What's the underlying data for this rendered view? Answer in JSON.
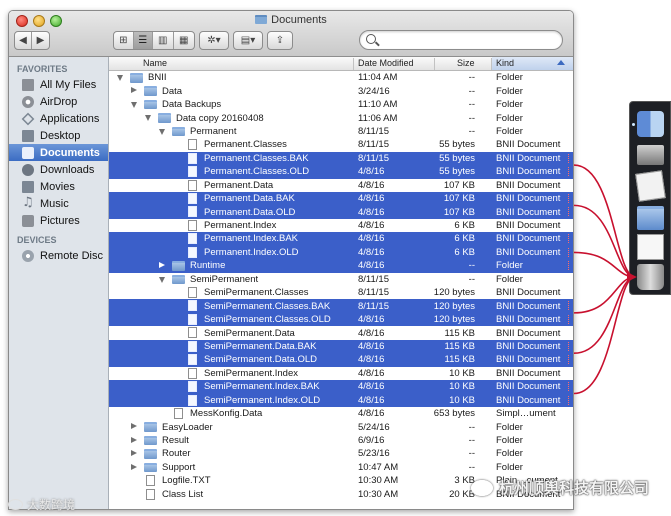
{
  "window": {
    "title": "Documents"
  },
  "toolbar": {
    "back_symbol": "◀",
    "forward_symbol": "▶",
    "view_icons": "⊞",
    "view_list": "☰",
    "view_columns": "▥",
    "view_coverflow": "▦",
    "action_symbol": "✲▾",
    "arrange_symbol": "▤▾",
    "share_symbol": "⇪",
    "search_value": "",
    "search_placeholder": ""
  },
  "sidebar": {
    "favorites_header": "FAVORITES",
    "devices_header": "DEVICES",
    "favorites": [
      {
        "label": "All My Files",
        "icon": "files-icon"
      },
      {
        "label": "AirDrop",
        "icon": "airdrop-icon"
      },
      {
        "label": "Applications",
        "icon": "applications-icon"
      },
      {
        "label": "Desktop",
        "icon": "desktop-icon"
      },
      {
        "label": "Documents",
        "icon": "documents-icon",
        "selected": true
      },
      {
        "label": "Downloads",
        "icon": "downloads-icon"
      },
      {
        "label": "Movies",
        "icon": "movies-icon"
      },
      {
        "label": "Music",
        "icon": "music-icon"
      },
      {
        "label": "Pictures",
        "icon": "pictures-icon"
      }
    ],
    "devices": [
      {
        "label": "Remote Disc",
        "icon": "disc-icon"
      }
    ]
  },
  "columns": {
    "name": "Name",
    "date": "Date Modified",
    "size": "Size",
    "kind": "Kind"
  },
  "rows": [
    {
      "name": "BNII",
      "date": "11:04 AM",
      "size": "--",
      "kind": "Folder",
      "type": "folder",
      "depth": 0,
      "disclosure": "open"
    },
    {
      "name": "Data",
      "date": "3/24/16",
      "size": "--",
      "kind": "Folder",
      "type": "folder",
      "depth": 1,
      "disclosure": "closed"
    },
    {
      "name": "Data Backups",
      "date": "11:10 AM",
      "size": "--",
      "kind": "Folder",
      "type": "folder",
      "depth": 1,
      "disclosure": "open"
    },
    {
      "name": "Data copy 20160408",
      "date": "11:06 AM",
      "size": "--",
      "kind": "Folder",
      "type": "folder",
      "depth": 2,
      "disclosure": "open"
    },
    {
      "name": "Permanent",
      "date": "8/11/15",
      "size": "--",
      "kind": "Folder",
      "type": "folder",
      "depth": 3,
      "disclosure": "open"
    },
    {
      "name": "Permanent.Classes",
      "date": "8/11/15",
      "size": "55 bytes",
      "kind": "BNII Document",
      "type": "doc",
      "depth": 4
    },
    {
      "name": "Permanent.Classes.BAK",
      "date": "8/11/15",
      "size": "55 bytes",
      "kind": "BNII Document",
      "type": "doc",
      "depth": 4,
      "selected": true
    },
    {
      "name": "Permanent.Classes.OLD",
      "date": "4/8/16",
      "size": "55 bytes",
      "kind": "BNII Document",
      "type": "doc",
      "depth": 4,
      "selected": true
    },
    {
      "name": "Permanent.Data",
      "date": "4/8/16",
      "size": "107 KB",
      "kind": "BNII Document",
      "type": "doc",
      "depth": 4
    },
    {
      "name": "Permanent.Data.BAK",
      "date": "4/8/16",
      "size": "107 KB",
      "kind": "BNII Document",
      "type": "doc",
      "depth": 4,
      "selected": true
    },
    {
      "name": "Permanent.Data.OLD",
      "date": "4/8/16",
      "size": "107 KB",
      "kind": "BNII Document",
      "type": "doc",
      "depth": 4,
      "selected": true
    },
    {
      "name": "Permanent.Index",
      "date": "4/8/16",
      "size": "6 KB",
      "kind": "BNII Document",
      "type": "doc",
      "depth": 4
    },
    {
      "name": "Permanent.Index.BAK",
      "date": "4/8/16",
      "size": "6 KB",
      "kind": "BNII Document",
      "type": "doc",
      "depth": 4,
      "selected": true
    },
    {
      "name": "Permanent.Index.OLD",
      "date": "4/8/16",
      "size": "6 KB",
      "kind": "BNII Document",
      "type": "doc",
      "depth": 4,
      "selected": true
    },
    {
      "name": "Runtime",
      "date": "4/8/16",
      "size": "--",
      "kind": "Folder",
      "type": "folder",
      "depth": 3,
      "disclosure": "closed",
      "selected": true
    },
    {
      "name": "SemiPermanent",
      "date": "8/11/15",
      "size": "--",
      "kind": "Folder",
      "type": "folder",
      "depth": 3,
      "disclosure": "open"
    },
    {
      "name": "SemiPermanent.Classes",
      "date": "8/11/15",
      "size": "120 bytes",
      "kind": "BNII Document",
      "type": "doc",
      "depth": 4
    },
    {
      "name": "SemiPermanent.Classes.BAK",
      "date": "8/11/15",
      "size": "120 bytes",
      "kind": "BNII Document",
      "type": "doc",
      "depth": 4,
      "selected": true
    },
    {
      "name": "SemiPermanent.Classes.OLD",
      "date": "4/8/16",
      "size": "120 bytes",
      "kind": "BNII Document",
      "type": "doc",
      "depth": 4,
      "selected": true
    },
    {
      "name": "SemiPermanent.Data",
      "date": "4/8/16",
      "size": "115 KB",
      "kind": "BNII Document",
      "type": "doc",
      "depth": 4
    },
    {
      "name": "SemiPermanent.Data.BAK",
      "date": "4/8/16",
      "size": "115 KB",
      "kind": "BNII Document",
      "type": "doc",
      "depth": 4,
      "selected": true
    },
    {
      "name": "SemiPermanent.Data.OLD",
      "date": "4/8/16",
      "size": "115 KB",
      "kind": "BNII Document",
      "type": "doc",
      "depth": 4,
      "selected": true
    },
    {
      "name": "SemiPermanent.Index",
      "date": "4/8/16",
      "size": "10 KB",
      "kind": "BNII Document",
      "type": "doc",
      "depth": 4
    },
    {
      "name": "SemiPermanent.Index.BAK",
      "date": "4/8/16",
      "size": "10 KB",
      "kind": "BNII Document",
      "type": "doc",
      "depth": 4,
      "selected": true
    },
    {
      "name": "SemiPermanent.Index.OLD",
      "date": "4/8/16",
      "size": "10 KB",
      "kind": "BNII Document",
      "type": "doc",
      "depth": 4,
      "selected": true
    },
    {
      "name": "MessKonfig.Data",
      "date": "4/8/16",
      "size": "653 bytes",
      "kind": "Simpl…ument",
      "type": "doc",
      "depth": 3
    },
    {
      "name": "EasyLoader",
      "date": "5/24/16",
      "size": "--",
      "kind": "Folder",
      "type": "folder",
      "depth": 1,
      "disclosure": "closed"
    },
    {
      "name": "Result",
      "date": "6/9/16",
      "size": "--",
      "kind": "Folder",
      "type": "folder",
      "depth": 1,
      "disclosure": "closed"
    },
    {
      "name": "Router",
      "date": "5/23/16",
      "size": "--",
      "kind": "Folder",
      "type": "folder",
      "depth": 1,
      "disclosure": "closed"
    },
    {
      "name": "Support",
      "date": "10:47 AM",
      "size": "--",
      "kind": "Folder",
      "type": "folder",
      "depth": 1,
      "disclosure": "closed"
    },
    {
      "name": "Logfile.TXT",
      "date": "10:30 AM",
      "size": "3 KB",
      "kind": "Plain…cument",
      "type": "doc",
      "depth": 1
    },
    {
      "name": "Class List",
      "date": "10:30 AM",
      "size": "20 KB",
      "kind": "BNII Document",
      "type": "doc",
      "depth": 1
    }
  ],
  "dock": {
    "items": [
      "finder-icon",
      "keyboard-icon",
      "document-icon",
      "applications-folder-icon",
      "text-document-icon",
      "trash-icon"
    ],
    "arrow_color": "#c8102e"
  },
  "watermarks": {
    "left": "大数跨境",
    "right": "杭州顺舆科技有限公司"
  },
  "colors": {
    "selection": "#3b5fc9",
    "sidebar_bg": "#dfe4ea",
    "sidebar_selected": "#3b6cc3"
  }
}
